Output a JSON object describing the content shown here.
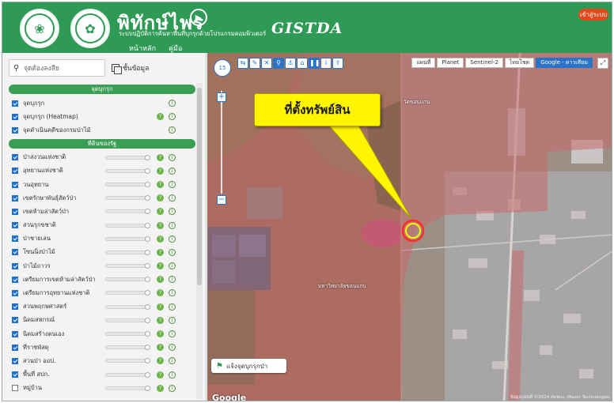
{
  "header": {
    "app_title": "พิทักษ์ไพร",
    "app_subtitle": "ระบบปฏิบัติการค้นหาพื้นที่บุกรุกด้วยโปรแกรมคอมพิวเตอร์",
    "agency_logo": "GISTDA",
    "tabs": [
      {
        "label": "หน้าหลัก",
        "active": true
      },
      {
        "label": "คู่มือ",
        "active": false
      }
    ],
    "login_label": "เข้าสู่ระบบ"
  },
  "sidebar": {
    "search_placeholder": "จุดต้องลงสีย",
    "layers_button": "ชั้นข้อมูล",
    "sections": [
      {
        "title": "จุดบุกรุก",
        "items": [
          {
            "label": "จุดบุกรุก",
            "checked": true,
            "slider": false,
            "help": false,
            "info": true
          },
          {
            "label": "จุดบุกรุก (Heatmap)",
            "checked": true,
            "slider": false,
            "help": true,
            "info": true
          },
          {
            "label": "จุดดำเนินคดีของกรมป่าไม้",
            "checked": true,
            "slider": false,
            "help": false,
            "info": true
          }
        ]
      },
      {
        "title": "ที่ดินของรัฐ",
        "items": [
          {
            "label": "ป่าสงวนแห่งชาติ",
            "checked": true,
            "slider": true,
            "help": true,
            "info": true
          },
          {
            "label": "อุทยานแห่งชาติ",
            "checked": true,
            "slider": true,
            "help": true,
            "info": true
          },
          {
            "label": "วนอุทยาน",
            "checked": true,
            "slider": true,
            "help": true,
            "info": true
          },
          {
            "label": "เขตรักษาพันธุ์สัตว์ป่า",
            "checked": true,
            "slider": true,
            "help": true,
            "info": true
          },
          {
            "label": "เขตห้ามล่าสัตว์ป่า",
            "checked": true,
            "slider": true,
            "help": true,
            "info": true
          },
          {
            "label": "สวนรุกขชาติ",
            "checked": true,
            "slider": true,
            "help": true,
            "info": true
          },
          {
            "label": "ป่าชายเลน",
            "checked": true,
            "slider": true,
            "help": true,
            "info": true
          },
          {
            "label": "โซนนิ่งป่าไม้",
            "checked": true,
            "slider": true,
            "help": true,
            "info": true
          },
          {
            "label": "ป่าไม้ถาวร",
            "checked": true,
            "slider": true,
            "help": true,
            "info": true
          },
          {
            "label": "เตรียมการเขตห้ามล่าสัตว์ป่า",
            "checked": true,
            "slider": true,
            "help": true,
            "info": true
          },
          {
            "label": "เตรียมการอุทยานแห่งชาติ",
            "checked": true,
            "slider": true,
            "help": true,
            "info": true
          },
          {
            "label": "สวนพฤกษศาสตร์",
            "checked": true,
            "slider": true,
            "help": true,
            "info": true
          },
          {
            "label": "นิคมสหกรณ์",
            "checked": true,
            "slider": true,
            "help": true,
            "info": true
          },
          {
            "label": "นิคมสร้างตนเอง",
            "checked": true,
            "slider": true,
            "help": true,
            "info": true
          },
          {
            "label": "ที่ราชพัสดุ",
            "checked": true,
            "slider": true,
            "help": true,
            "info": true
          },
          {
            "label": "สวนป่า ออป.",
            "checked": true,
            "slider": true,
            "help": true,
            "info": true
          },
          {
            "label": "พื้นที่ สปก.",
            "checked": true,
            "slider": true,
            "help": true,
            "info": true
          },
          {
            "label": "หมู่บ้าน",
            "checked": false,
            "slider": true,
            "help": true,
            "info": true
          }
        ]
      }
    ]
  },
  "map": {
    "basemaps": [
      {
        "label": "แผนที่",
        "active": false
      },
      {
        "label": "Planet",
        "active": false
      },
      {
        "label": "Sentinel-2",
        "active": false
      },
      {
        "label": "ไทยโชต",
        "active": false
      },
      {
        "label": "Google - ดาวเทียม",
        "active": true
      }
    ],
    "compass_label": "15",
    "callout_text": "ที่ตั้งทรัพย์สิน",
    "report_button": "แจ้งจุดบุกรุกป่า",
    "google_logo": "Google",
    "labels": [
      {
        "text": "วัดขอนแก่น"
      },
      {
        "text": "มหาวิทยาลัยขอนแก่น"
      }
    ],
    "copyright": "ข้อมูลแผนที่ ©2024 Airbus, Maxar Technologies",
    "colors": {
      "overlay": "#c96a6a",
      "highlight": "#ff2a2a",
      "callout": "#fff500",
      "brand": "#2e9a55"
    }
  }
}
